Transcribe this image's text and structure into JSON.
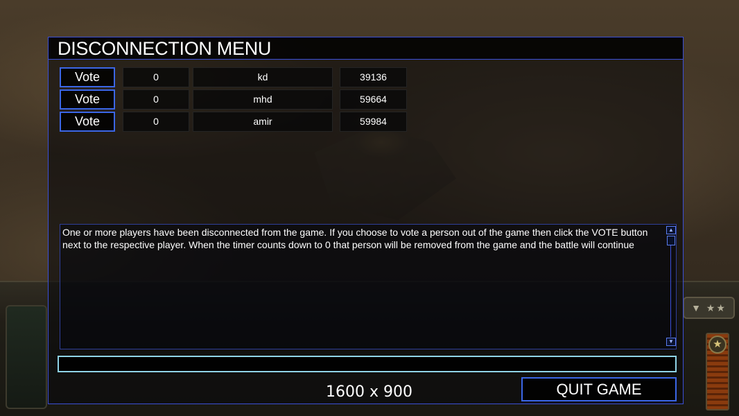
{
  "dialog": {
    "title": "DISCONNECTION MENU"
  },
  "players": [
    {
      "vote_label": "Vote",
      "timer": "0",
      "name": "kd",
      "ping": "39136"
    },
    {
      "vote_label": "Vote",
      "timer": "0",
      "name": "mhd",
      "ping": "59664"
    },
    {
      "vote_label": "Vote",
      "timer": "0",
      "name": "amir",
      "ping": "59984"
    }
  ],
  "message": {
    "text": "One or more players have been disconnected from the game. If you choose to vote a person out of the game then click the VOTE button next to the respective player. When the timer counts down to 0 that person will be removed from the game and the battle will continue"
  },
  "chat_input": {
    "value": ""
  },
  "footer": {
    "resolution": "1600 x 900",
    "quit_label": "QUIT GAME"
  },
  "hud": {
    "buttons_text": "▼ ★★"
  },
  "colors": {
    "accent_border": "#3b66e6",
    "panel_border": "#3b4fd8",
    "input_border": "#8fd3e6"
  }
}
